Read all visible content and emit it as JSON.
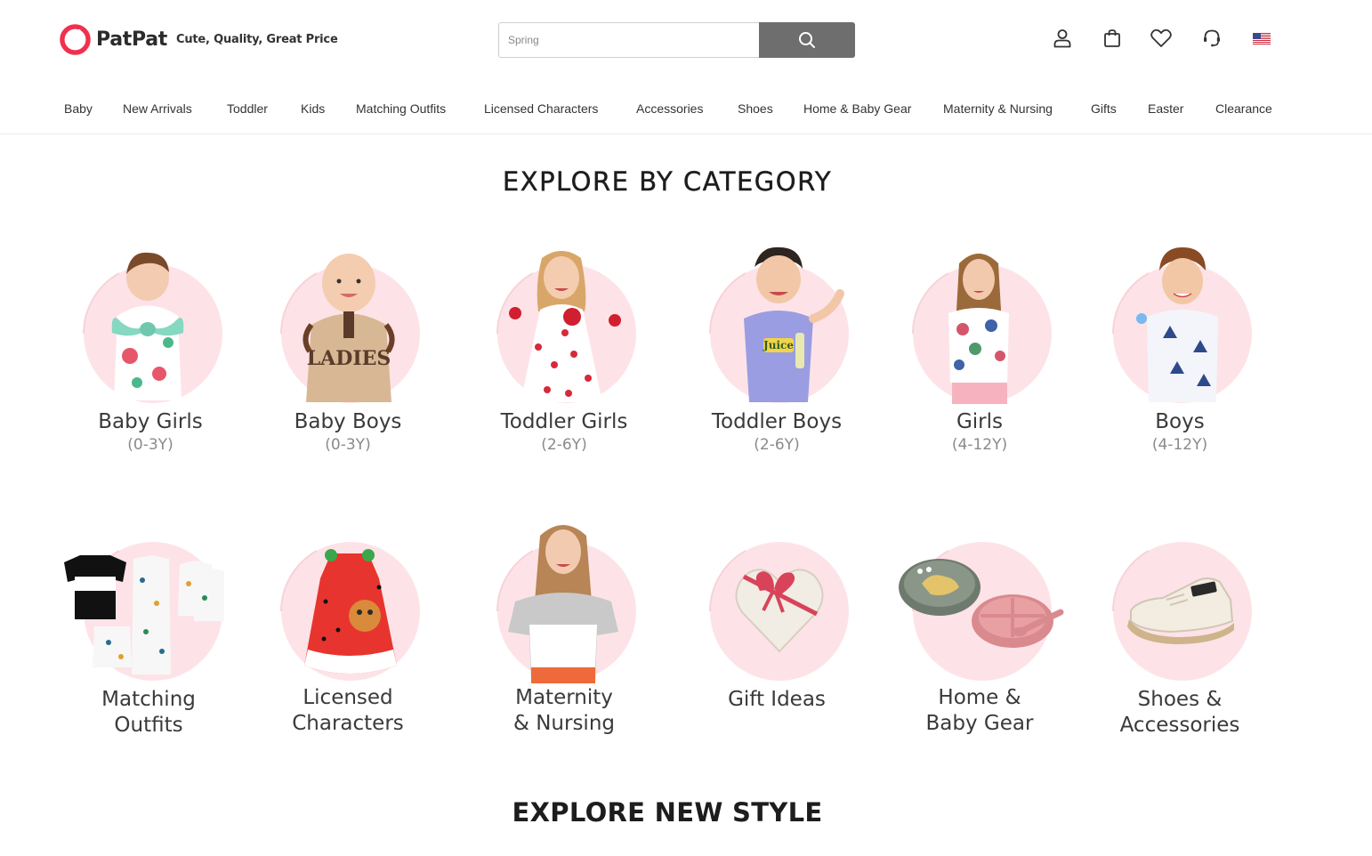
{
  "brand": {
    "name": "PatPat",
    "tagline": "Cute, Quality, Great Price"
  },
  "search": {
    "placeholder": "Spring",
    "button_icon": "search-icon"
  },
  "header_icons": [
    "user-icon",
    "bag-icon",
    "heart-icon",
    "headset-icon",
    "us-flag-icon"
  ],
  "nav": [
    "Baby",
    "New Arrivals",
    "Toddler",
    "Kids",
    "Matching Outfits",
    "Licensed Characters",
    "Accessories",
    "Shoes",
    "Home & Baby Gear",
    "Maternity & Nursing",
    "Gifts",
    "Easter",
    "Clearance"
  ],
  "sections": {
    "explore_category": "EXPLORE BY CATEGORY",
    "explore_new_style": "EXPLORE NEW STYLE"
  },
  "categories": [
    {
      "name": "Baby Girls",
      "age": "(0-3Y)",
      "image": "baby-girl-floral-romper"
    },
    {
      "name": "Baby Boys",
      "age": "(0-3Y)",
      "image": "baby-boy-ladies-romper"
    },
    {
      "name": "Toddler Girls",
      "age": "(2-6Y)",
      "image": "toddler-girl-strawberry-dress"
    },
    {
      "name": "Toddler Boys",
      "age": "(2-6Y)",
      "image": "toddler-boy-juice-tee"
    },
    {
      "name": "Girls",
      "age": "(4-12Y)",
      "image": "girl-floral-top"
    },
    {
      "name": "Boys",
      "age": "(4-12Y)",
      "image": "boy-palm-print-shirt"
    },
    {
      "name": "Matching Outfits",
      "lines": [
        "Matching",
        "Outfits"
      ],
      "image": "family-dinosaur-outfits"
    },
    {
      "name": "Licensed Characters",
      "lines": [
        "Licensed",
        "Characters"
      ],
      "image": "watermelon-character-dress"
    },
    {
      "name": "Maternity & Nursing",
      "lines": [
        "Maternity",
        "& Nursing"
      ],
      "image": "maternity-colorblock-tee"
    },
    {
      "name": "Gift Ideas",
      "lines": [
        "Gift Ideas"
      ],
      "image": "heart-gift-box"
    },
    {
      "name": "Home & Baby Gear",
      "lines": [
        "Home &",
        "Baby Gear"
      ],
      "image": "suction-plates"
    },
    {
      "name": "Shoes & Accessories",
      "lines": [
        "Shoes &",
        "Accessories"
      ],
      "image": "baby-sneaker"
    }
  ],
  "colors": {
    "brand_red": "#f1304d",
    "circle_pink": "#fde3e7",
    "search_button": "#6e6e6e"
  }
}
